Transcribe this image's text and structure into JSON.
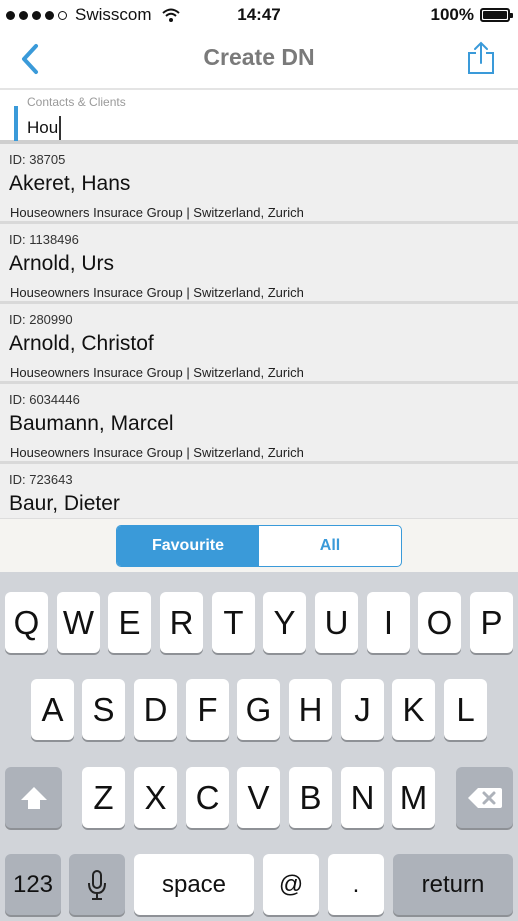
{
  "status_bar": {
    "carrier": "Swisscom",
    "time": "14:47",
    "battery": "100%"
  },
  "nav": {
    "title": "Create DN"
  },
  "search": {
    "label": "Contacts & Clients",
    "value": "Hou"
  },
  "contacts": [
    {
      "id": "ID: 38705",
      "name": "Akeret, Hans",
      "subtitle": "Houseowners Insurace Group | Switzerland, Zurich"
    },
    {
      "id": "ID: 1138496",
      "name": "Arnold, Urs",
      "subtitle": "Houseowners Insurace Group | Switzerland, Zurich"
    },
    {
      "id": "ID: 280990",
      "name": "Arnold, Christof",
      "subtitle": "Houseowners Insurace Group | Switzerland, Zurich"
    },
    {
      "id": "ID: 6034446",
      "name": "Baumann, Marcel",
      "subtitle": "Houseowners Insurace Group | Switzerland, Zurich"
    },
    {
      "id": "ID: 723643",
      "name": "Baur, Dieter",
      "subtitle": ""
    }
  ],
  "segment": {
    "favourite": "Favourite",
    "all": "All",
    "selected": "favourite"
  },
  "keyboard": {
    "row1": [
      "Q",
      "W",
      "E",
      "R",
      "T",
      "Y",
      "U",
      "I",
      "O",
      "P"
    ],
    "row2": [
      "A",
      "S",
      "D",
      "F",
      "G",
      "H",
      "J",
      "K",
      "L"
    ],
    "row3": [
      "Z",
      "X",
      "C",
      "V",
      "B",
      "N",
      "M"
    ],
    "numbers": "123",
    "space": "space",
    "at": "@",
    "period": ".",
    "return": "return"
  },
  "colors": {
    "accent": "#3a9ad9",
    "keyboard_bg": "#d1d4d9"
  }
}
